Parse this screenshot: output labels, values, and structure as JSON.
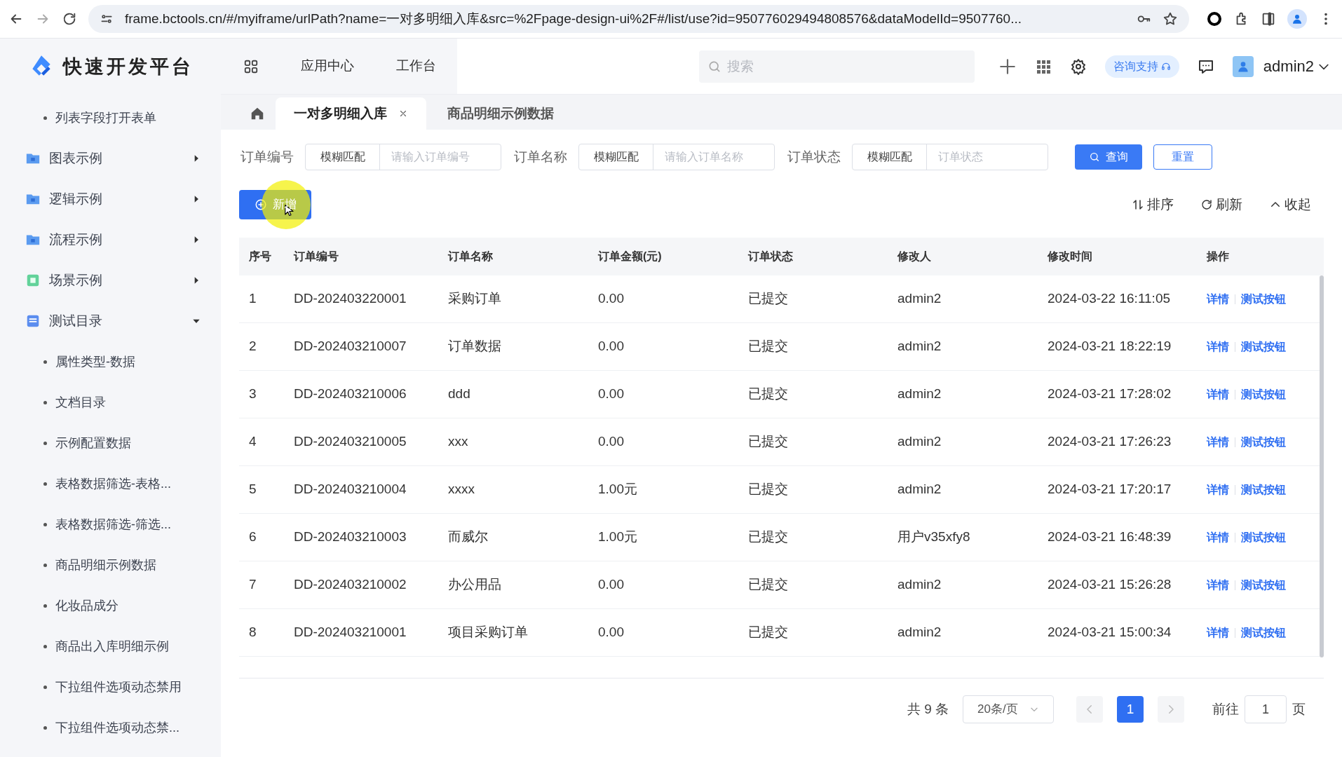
{
  "browser": {
    "url": "frame.bctools.cn/#/myiframe/urlPath?name=一对多明细入库&src=%2Fpage-design-ui%2F#/list/use?id=950776029494808576&dataModelId=9507760..."
  },
  "brand": {
    "title": "快速开发平台"
  },
  "header": {
    "nav": [
      "应用中心",
      "工作台"
    ],
    "search": {
      "placeholder": "搜索"
    },
    "support": "咨询支持",
    "user": "admin2"
  },
  "sidebar": {
    "items": [
      {
        "label": "列表字段打开表单",
        "kind": "leaf"
      },
      {
        "label": "图表示例",
        "kind": "folder",
        "expanded": false
      },
      {
        "label": "逻辑示例",
        "kind": "folder",
        "expanded": false
      },
      {
        "label": "流程示例",
        "kind": "folder",
        "expanded": false
      },
      {
        "label": "场景示例",
        "kind": "scene",
        "expanded": false
      },
      {
        "label": "测试目录",
        "kind": "catalog",
        "expanded": true,
        "children": [
          {
            "label": "属性类型-数据",
            "kind": "leaf"
          },
          {
            "label": "文档目录",
            "kind": "leaf"
          },
          {
            "label": "示例配置数据",
            "kind": "leaf"
          },
          {
            "label": "表格数据筛选-表格...",
            "kind": "leaf"
          },
          {
            "label": "表格数据筛选-筛选...",
            "kind": "leaf"
          },
          {
            "label": "商品明细示例数据",
            "kind": "leaf"
          },
          {
            "label": "化妆品成分",
            "kind": "leaf"
          },
          {
            "label": "商品出入库明细示例",
            "kind": "leaf"
          },
          {
            "label": "下拉组件选项动态禁用",
            "kind": "leaf"
          },
          {
            "label": "下拉组件选项动态禁...",
            "kind": "leaf"
          }
        ]
      }
    ]
  },
  "tabs": [
    {
      "label": "一对多明细入库",
      "selected": true,
      "closable": true
    },
    {
      "label": "商品明细示例数据",
      "selected": false,
      "closable": false
    }
  ],
  "filters": [
    {
      "label": "订单编号",
      "mode": "模糊匹配",
      "placeholder": "请输入订单编号"
    },
    {
      "label": "订单名称",
      "mode": "模糊匹配",
      "placeholder": "请输入订单名称"
    },
    {
      "label": "订单状态",
      "mode": "模糊匹配",
      "placeholder": "订单状态"
    }
  ],
  "query_button": "查询",
  "reset_button": "重置",
  "add_button": "新增",
  "toolbar": [
    {
      "label": "排序",
      "kind": "sort"
    },
    {
      "label": "刷新",
      "kind": "refresh"
    },
    {
      "label": "收起",
      "kind": "collapse"
    }
  ],
  "table": {
    "columns": [
      "序号",
      "订单编号",
      "订单名称",
      "订单金额(元)",
      "订单状态",
      "修改人",
      "修改时间",
      "操作"
    ],
    "rows": [
      {
        "cells": [
          "1",
          "DD-202403220001",
          "采购订单",
          "0.00",
          "已提交",
          "admin2",
          "2024-03-22 16:11:05"
        ],
        "actions": [
          "详情",
          "测试按钮"
        ]
      },
      {
        "cells": [
          "2",
          "DD-202403210007",
          "订单数据",
          "0.00",
          "已提交",
          "admin2",
          "2024-03-21 18:22:19"
        ],
        "actions": [
          "详情",
          "测试按钮"
        ]
      },
      {
        "cells": [
          "3",
          "DD-202403210006",
          "ddd",
          "0.00",
          "已提交",
          "admin2",
          "2024-03-21 17:28:02"
        ],
        "actions": [
          "详情",
          "测试按钮"
        ]
      },
      {
        "cells": [
          "4",
          "DD-202403210005",
          "xxx",
          "0.00",
          "已提交",
          "admin2",
          "2024-03-21 17:26:23"
        ],
        "actions": [
          "详情",
          "测试按钮"
        ]
      },
      {
        "cells": [
          "5",
          "DD-202403210004",
          "xxxx",
          "1.00元",
          "已提交",
          "admin2",
          "2024-03-21 17:20:17"
        ],
        "actions": [
          "详情",
          "测试按钮"
        ]
      },
      {
        "cells": [
          "6",
          "DD-202403210003",
          "而威尔",
          "1.00元",
          "已提交",
          "用户v35xfy8",
          "2024-03-21 16:48:39"
        ],
        "actions": [
          "详情",
          "测试按钮"
        ]
      },
      {
        "cells": [
          "7",
          "DD-202403210002",
          "办公用品",
          "0.00",
          "已提交",
          "admin2",
          "2024-03-21 15:26:28"
        ],
        "actions": [
          "详情",
          "测试按钮"
        ]
      },
      {
        "cells": [
          "8",
          "DD-202403210001",
          "项目采购订单",
          "0.00",
          "已提交",
          "admin2",
          "2024-03-21 15:00:34"
        ],
        "actions": [
          "详情",
          "测试按钮"
        ]
      }
    ]
  },
  "pagination": {
    "total": "共 9 条",
    "page_size": "20条/页",
    "pages": [
      {
        "label": "1",
        "selected": true
      }
    ],
    "goto_label": "前往",
    "goto_value": "1",
    "goto_suffix": "页"
  }
}
